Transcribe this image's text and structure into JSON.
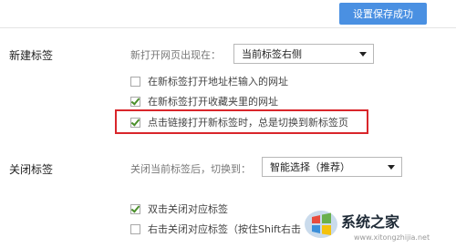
{
  "header": {
    "save_label": "设置保存成功"
  },
  "new_tab": {
    "section_title": "新建标签",
    "open_position_label": "新打开网页出现在：",
    "open_position_value": "当前标签右侧",
    "options": [
      {
        "label": "在新标签打开地址栏输入的网址",
        "checked": false
      },
      {
        "label": "在新标签打开收藏夹里的网址",
        "checked": true
      },
      {
        "label": "点击链接打开新标签时，总是切换到新标签页",
        "checked": true
      }
    ]
  },
  "close_tab": {
    "section_title": "关闭标签",
    "after_close_label": "关闭当前标签后，切换到：",
    "after_close_value": "智能选择（推荐）",
    "options": [
      {
        "label": "双击关闭对应标签",
        "checked": true
      },
      {
        "label": "右击关闭对应标签（按住Shift右击",
        "checked": false
      }
    ]
  },
  "watermark": {
    "brand": "系统之家",
    "url": "www.xitongzhijia.net"
  },
  "colors": {
    "accent": "#4a90e2",
    "highlight": "#d9262b",
    "check": "#4a8f2a"
  }
}
